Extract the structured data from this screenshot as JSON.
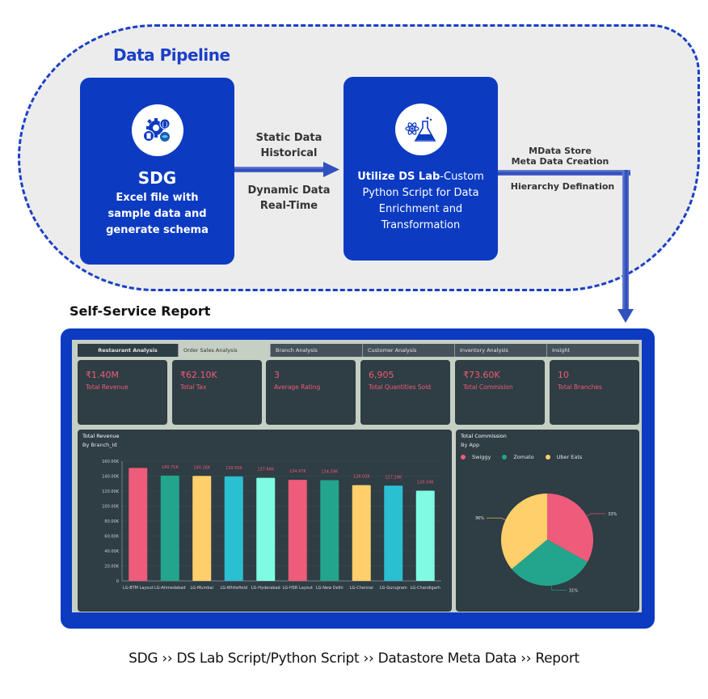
{
  "pipeline": {
    "title": "Data Pipeline",
    "sdg_box": {
      "icon": "gears-code-docker-icon",
      "title": "SDG",
      "lines": [
        "Excel file with",
        "sample data and",
        "generate schema"
      ]
    },
    "arrow1": {
      "top_lines": [
        "Static Data",
        "Historical"
      ],
      "bottom_lines": [
        "Dynamic Data",
        "Real-Time"
      ]
    },
    "dslab_box": {
      "icon": "science-flask-atom-icon",
      "bold_prefix": "Utilize DS Lab",
      "lines_first_rest": "-Custom",
      "lines": [
        "Python Script for Data",
        "Enrichment and",
        "Transformation"
      ]
    },
    "arrow2": {
      "top_lines": [
        "MData Store",
        "Meta Data Creation"
      ],
      "bottom_lines": [
        "Hierarchy Defination"
      ]
    }
  },
  "report": {
    "title": "Self-Service Report",
    "tabs": [
      {
        "label": "Restaurant Analysis",
        "state": "dark"
      },
      {
        "label": "Order Sales Analysis",
        "state": "active"
      },
      {
        "label": "Branch Analysis",
        "state": "normal"
      },
      {
        "label": "Customer Analysis",
        "state": "normal"
      },
      {
        "label": "Inventory Analysis",
        "state": "normal"
      },
      {
        "label": "Insight",
        "state": "normal"
      }
    ],
    "kpis": [
      {
        "value": "₹1.40M",
        "label": "Total Revenue"
      },
      {
        "value": "₹62.10K",
        "label": "Total Tax"
      },
      {
        "value": "3",
        "label": "Average Rating"
      },
      {
        "value": "6,905",
        "label": "Total Quantities Sold"
      },
      {
        "value": "₹73.60K",
        "label": "Total Commision"
      },
      {
        "value": "10",
        "label": "Total Branches"
      }
    ],
    "colors": {
      "kpi_text": "#ef5b74",
      "panel_bg": "#2f3d44",
      "frame": "#0c3bc2"
    }
  },
  "chart_data": [
    {
      "type": "bar",
      "title": "Total Revenue",
      "subtitle": "By Branch_Id",
      "categories": [
        "LG-BTM Layout",
        "LG-Ahmedabad",
        "LG-Mumbai",
        "LG-Whitefield",
        "LG-Hyderabad",
        "LG-HSR Layout",
        "LG-New Delhi",
        "LG-Chennai",
        "LG-Gurugram",
        "LG-Chandigarh"
      ],
      "values": [
        151.0,
        140.71,
        140.26,
        139.55,
        137.66,
        134.97,
        134.59,
        128.02,
        127.29,
        120.54
      ],
      "data_labels": [
        "",
        "140.71K",
        "140.26K",
        "139.55K",
        "137.66K",
        "134.97K",
        "134.59K",
        "128.02K",
        "127.29K",
        "120.54K"
      ],
      "bar_colors": [
        "#ef5b7a",
        "#22a58c",
        "#fecf6a",
        "#2bbfd2",
        "#7ffbe4",
        "#ef5b7a",
        "#22a58c",
        "#fecf6a",
        "#2bbfd2",
        "#7ffbe4"
      ],
      "yticks": [
        "0",
        "20.00K",
        "40.00K",
        "60.00K",
        "80.00K",
        "100.00K",
        "120.00K",
        "140.00K",
        "160.00K"
      ],
      "ylim": [
        0,
        160
      ],
      "yunit": "K",
      "xlabel": "",
      "ylabel": "",
      "grid": true
    },
    {
      "type": "pie",
      "title": "Total Commission",
      "subtitle": "By App",
      "legend_position": "top-left",
      "slices": [
        {
          "name": "Swiggy",
          "value": 33,
          "label": "33%",
          "color": "#ef5b7a"
        },
        {
          "name": "Zomato",
          "value": 31,
          "label": "31%",
          "color": "#22a58c"
        },
        {
          "name": "Uber Eats",
          "value": 36,
          "label": "36%",
          "color": "#fecf6a"
        }
      ]
    }
  ],
  "caption": "SDG  ››  DS Lab Script/Python Script  ››  Datastore Meta Data ››  Report"
}
